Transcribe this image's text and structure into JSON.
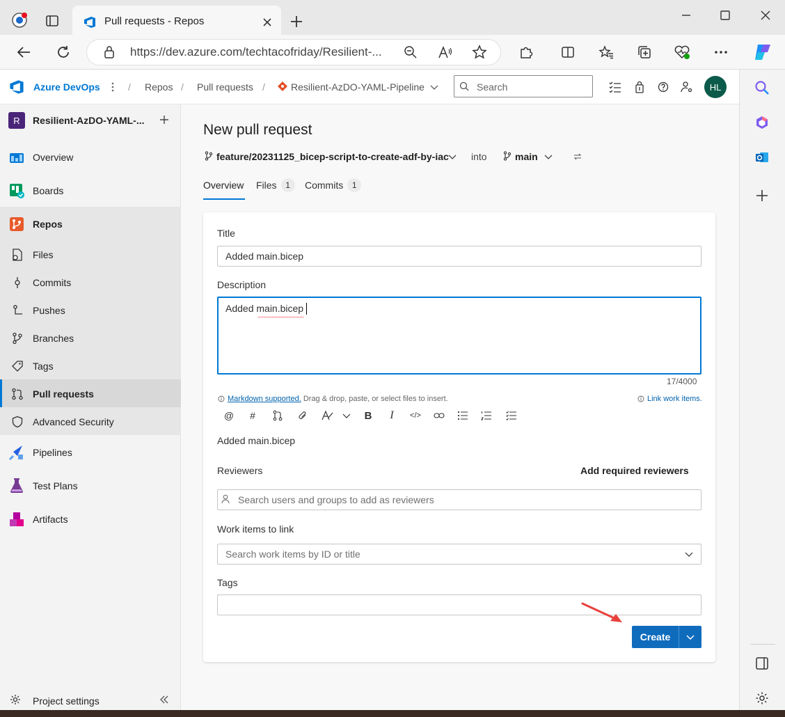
{
  "browser": {
    "tab_title": "Pull requests - Repos",
    "url": "https://dev.azure.com/techtacofriday/Resilient-..."
  },
  "header": {
    "brand": "Azure DevOps",
    "breadcrumb": [
      "Repos",
      "Pull requests",
      "Resilient-AzDO-YAML-Pipeline"
    ],
    "search_placeholder": "Search",
    "avatar_initials": "HL"
  },
  "sidebar": {
    "project_initial": "R",
    "project_name": "Resilient-AzDO-YAML-...",
    "items": [
      {
        "label": "Overview"
      },
      {
        "label": "Boards"
      },
      {
        "label": "Repos"
      },
      {
        "label": "Files"
      },
      {
        "label": "Commits"
      },
      {
        "label": "Pushes"
      },
      {
        "label": "Branches"
      },
      {
        "label": "Tags"
      },
      {
        "label": "Pull requests"
      },
      {
        "label": "Advanced Security"
      },
      {
        "label": "Pipelines"
      },
      {
        "label": "Test Plans"
      },
      {
        "label": "Artifacts"
      }
    ],
    "settings_label": "Project settings"
  },
  "page": {
    "title": "New pull request",
    "source_branch": "feature/20231125_bicep-script-to-create-adf-by-iac",
    "into_label": "into",
    "target_branch": "main",
    "tabs": [
      {
        "label": "Overview"
      },
      {
        "label": "Files",
        "count": "1"
      },
      {
        "label": "Commits",
        "count": "1"
      }
    ]
  },
  "form": {
    "title_label": "Title",
    "title_value": "Added main.bicep",
    "description_label": "Description",
    "description_value": "Added main.bicep",
    "char_count": "17/4000",
    "markdown_link": "Markdown supported.",
    "markdown_hint": " Drag & drop, paste, or select files to insert.",
    "link_work_items": "Link work items.",
    "preview_text": "Added main.bicep",
    "reviewers_label": "Reviewers",
    "add_required_reviewers": "Add required reviewers",
    "reviewers_placeholder": "Search users and groups to add as reviewers",
    "work_items_label": "Work items to link",
    "work_items_placeholder": "Search work items by ID or title",
    "tags_label": "Tags",
    "create_label": "Create"
  },
  "colors": {
    "accent": "#0f6cbd",
    "brand": "#0078d4",
    "annotation_arrow": "#e8413c"
  }
}
